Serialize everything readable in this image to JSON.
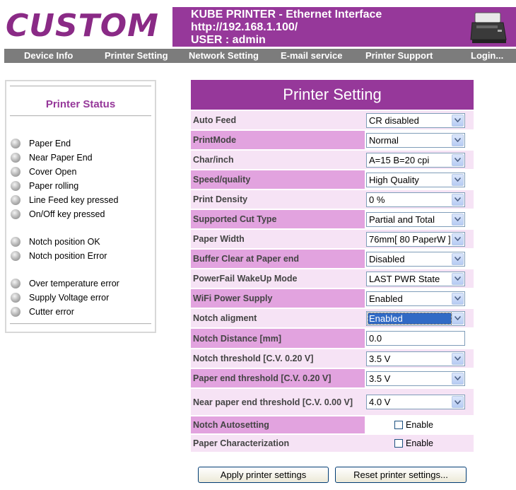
{
  "header": {
    "logo": "CUSTOM",
    "banner_line1": "KUBE PRINTER - Ethernet Interface",
    "banner_line2": "http://192.168.1.100/",
    "banner_line3": "USER : admin"
  },
  "nav": [
    "Device Info",
    "Printer Setting",
    "Network Setting",
    "E-mail service",
    "Printer Support",
    "Login..."
  ],
  "status": {
    "title": "Printer Status",
    "items": [
      "Paper End",
      "Near Paper End",
      "Cover Open",
      "Paper rolling",
      "Line Feed key pressed",
      "On/Off key pressed",
      "Notch position OK",
      "Notch position Error",
      "Over temperature error",
      "Supply Voltage error",
      "Cutter error"
    ]
  },
  "settings": {
    "title": "Printer Setting",
    "rows": [
      {
        "label": "Auto Feed",
        "value": "CR disabled"
      },
      {
        "label": "PrintMode",
        "value": "Normal"
      },
      {
        "label": "Char/inch",
        "value": "A=15 B=20 cpi"
      },
      {
        "label": "Speed/quality",
        "value": "High Quality"
      },
      {
        "label": "Print Density",
        "value": "0 %"
      },
      {
        "label": "Supported Cut Type",
        "value": "Partial and Total"
      },
      {
        "label": "Paper Width",
        "value": "76mm[ 80 PaperW ]"
      },
      {
        "label": "Buffer Clear at Paper end",
        "value": "Disabled"
      },
      {
        "label": "PowerFail WakeUp Mode",
        "value": "LAST PWR State"
      },
      {
        "label": "WiFi Power Supply",
        "value": "Enabled"
      },
      {
        "label": "Notch aligment",
        "value": "Enabled"
      },
      {
        "label": "Notch Distance [mm]",
        "value": "0.0"
      },
      {
        "label": "Notch threshold [C.V. 0.20 V]",
        "value": "3.5 V"
      },
      {
        "label": "Paper end threshold [C.V. 0.20 V]",
        "value": "3.5 V"
      },
      {
        "label": "Near paper end threshold [C.V. 0.00 V]",
        "value": "4.0 V"
      },
      {
        "label": "Notch Autosetting",
        "value": "Enable"
      },
      {
        "label": "Paper Characterization",
        "value": "Enable"
      }
    ]
  },
  "buttons": {
    "apply": "Apply printer settings",
    "reset": "Reset printer settings..."
  },
  "colors": {
    "brand_purple": "#96389a",
    "row_dark": "#e2a3df",
    "row_light": "#f6e3f5",
    "nav_gray": "#7c7c7c"
  }
}
